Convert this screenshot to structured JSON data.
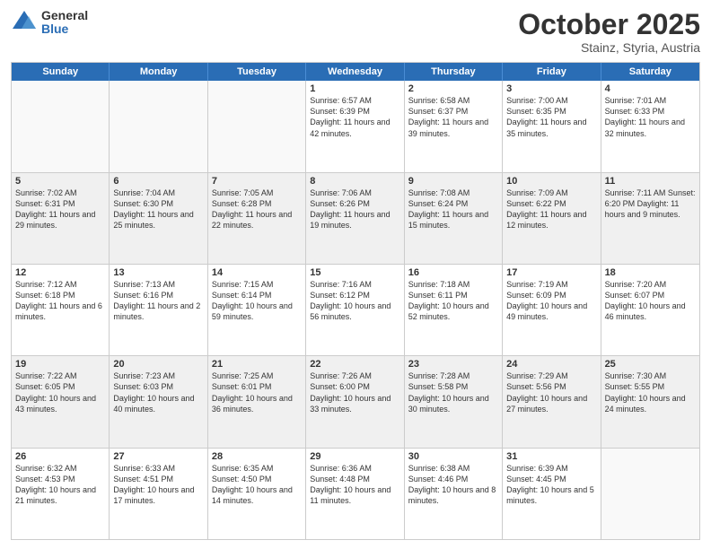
{
  "header": {
    "logo_general": "General",
    "logo_blue": "Blue",
    "month": "October 2025",
    "location": "Stainz, Styria, Austria"
  },
  "days_of_week": [
    "Sunday",
    "Monday",
    "Tuesday",
    "Wednesday",
    "Thursday",
    "Friday",
    "Saturday"
  ],
  "weeks": [
    [
      {
        "day": "",
        "info": ""
      },
      {
        "day": "",
        "info": ""
      },
      {
        "day": "",
        "info": ""
      },
      {
        "day": "1",
        "info": "Sunrise: 6:57 AM\nSunset: 6:39 PM\nDaylight: 11 hours and 42 minutes."
      },
      {
        "day": "2",
        "info": "Sunrise: 6:58 AM\nSunset: 6:37 PM\nDaylight: 11 hours and 39 minutes."
      },
      {
        "day": "3",
        "info": "Sunrise: 7:00 AM\nSunset: 6:35 PM\nDaylight: 11 hours and 35 minutes."
      },
      {
        "day": "4",
        "info": "Sunrise: 7:01 AM\nSunset: 6:33 PM\nDaylight: 11 hours and 32 minutes."
      }
    ],
    [
      {
        "day": "5",
        "info": "Sunrise: 7:02 AM\nSunset: 6:31 PM\nDaylight: 11 hours and 29 minutes."
      },
      {
        "day": "6",
        "info": "Sunrise: 7:04 AM\nSunset: 6:30 PM\nDaylight: 11 hours and 25 minutes."
      },
      {
        "day": "7",
        "info": "Sunrise: 7:05 AM\nSunset: 6:28 PM\nDaylight: 11 hours and 22 minutes."
      },
      {
        "day": "8",
        "info": "Sunrise: 7:06 AM\nSunset: 6:26 PM\nDaylight: 11 hours and 19 minutes."
      },
      {
        "day": "9",
        "info": "Sunrise: 7:08 AM\nSunset: 6:24 PM\nDaylight: 11 hours and 15 minutes."
      },
      {
        "day": "10",
        "info": "Sunrise: 7:09 AM\nSunset: 6:22 PM\nDaylight: 11 hours and 12 minutes."
      },
      {
        "day": "11",
        "info": "Sunrise: 7:11 AM\nSunset: 6:20 PM\nDaylight: 11 hours and 9 minutes."
      }
    ],
    [
      {
        "day": "12",
        "info": "Sunrise: 7:12 AM\nSunset: 6:18 PM\nDaylight: 11 hours and 6 minutes."
      },
      {
        "day": "13",
        "info": "Sunrise: 7:13 AM\nSunset: 6:16 PM\nDaylight: 11 hours and 2 minutes."
      },
      {
        "day": "14",
        "info": "Sunrise: 7:15 AM\nSunset: 6:14 PM\nDaylight: 10 hours and 59 minutes."
      },
      {
        "day": "15",
        "info": "Sunrise: 7:16 AM\nSunset: 6:12 PM\nDaylight: 10 hours and 56 minutes."
      },
      {
        "day": "16",
        "info": "Sunrise: 7:18 AM\nSunset: 6:11 PM\nDaylight: 10 hours and 52 minutes."
      },
      {
        "day": "17",
        "info": "Sunrise: 7:19 AM\nSunset: 6:09 PM\nDaylight: 10 hours and 49 minutes."
      },
      {
        "day": "18",
        "info": "Sunrise: 7:20 AM\nSunset: 6:07 PM\nDaylight: 10 hours and 46 minutes."
      }
    ],
    [
      {
        "day": "19",
        "info": "Sunrise: 7:22 AM\nSunset: 6:05 PM\nDaylight: 10 hours and 43 minutes."
      },
      {
        "day": "20",
        "info": "Sunrise: 7:23 AM\nSunset: 6:03 PM\nDaylight: 10 hours and 40 minutes."
      },
      {
        "day": "21",
        "info": "Sunrise: 7:25 AM\nSunset: 6:01 PM\nDaylight: 10 hours and 36 minutes."
      },
      {
        "day": "22",
        "info": "Sunrise: 7:26 AM\nSunset: 6:00 PM\nDaylight: 10 hours and 33 minutes."
      },
      {
        "day": "23",
        "info": "Sunrise: 7:28 AM\nSunset: 5:58 PM\nDaylight: 10 hours and 30 minutes."
      },
      {
        "day": "24",
        "info": "Sunrise: 7:29 AM\nSunset: 5:56 PM\nDaylight: 10 hours and 27 minutes."
      },
      {
        "day": "25",
        "info": "Sunrise: 7:30 AM\nSunset: 5:55 PM\nDaylight: 10 hours and 24 minutes."
      }
    ],
    [
      {
        "day": "26",
        "info": "Sunrise: 6:32 AM\nSunset: 4:53 PM\nDaylight: 10 hours and 21 minutes."
      },
      {
        "day": "27",
        "info": "Sunrise: 6:33 AM\nSunset: 4:51 PM\nDaylight: 10 hours and 17 minutes."
      },
      {
        "day": "28",
        "info": "Sunrise: 6:35 AM\nSunset: 4:50 PM\nDaylight: 10 hours and 14 minutes."
      },
      {
        "day": "29",
        "info": "Sunrise: 6:36 AM\nSunset: 4:48 PM\nDaylight: 10 hours and 11 minutes."
      },
      {
        "day": "30",
        "info": "Sunrise: 6:38 AM\nSunset: 4:46 PM\nDaylight: 10 hours and 8 minutes."
      },
      {
        "day": "31",
        "info": "Sunrise: 6:39 AM\nSunset: 4:45 PM\nDaylight: 10 hours and 5 minutes."
      },
      {
        "day": "",
        "info": ""
      }
    ]
  ]
}
